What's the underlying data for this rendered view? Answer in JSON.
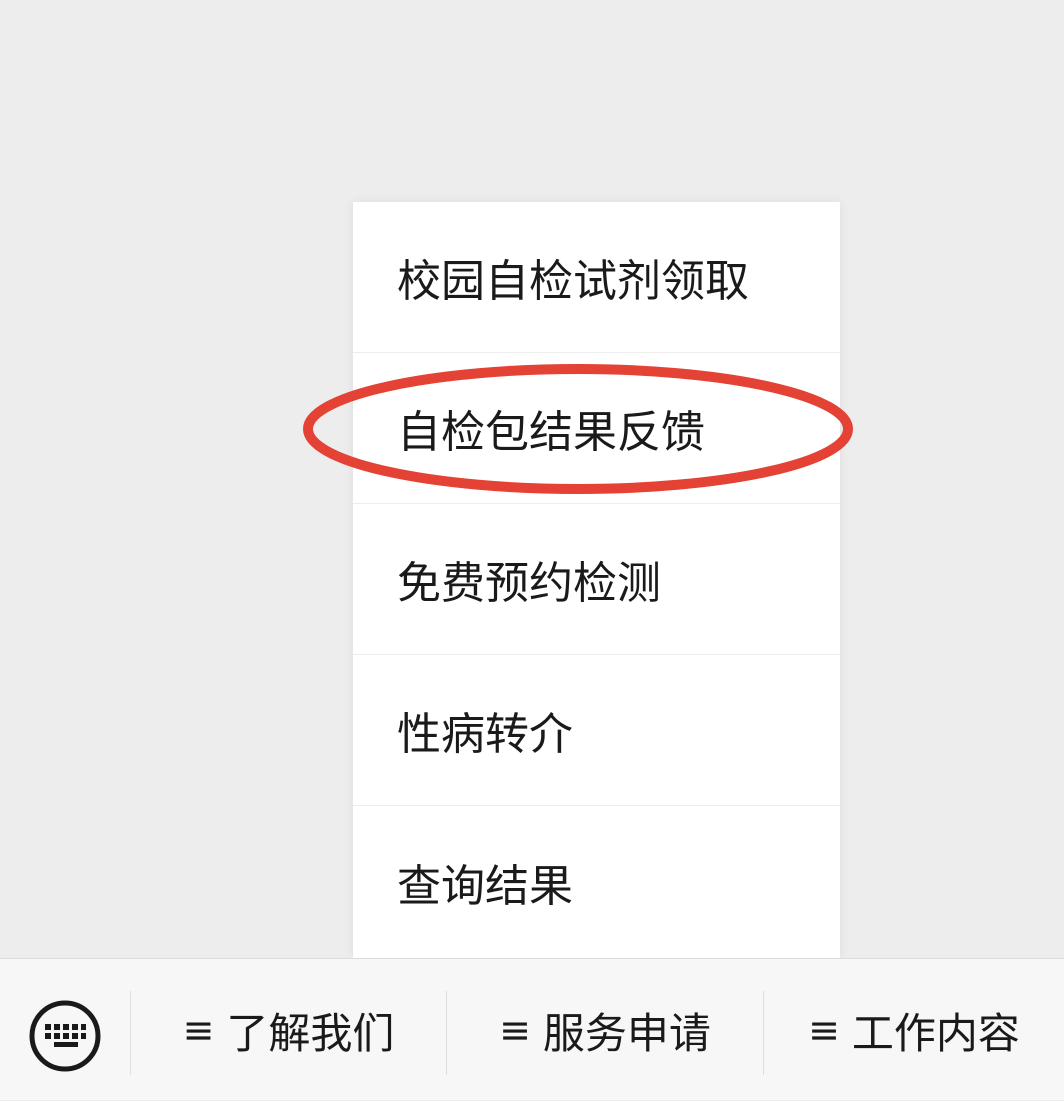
{
  "popup_menu": {
    "items": [
      {
        "label": "校园自检试剂领取"
      },
      {
        "label": "自检包结果反馈"
      },
      {
        "label": "免费预约检测"
      },
      {
        "label": "性病转介"
      },
      {
        "label": "查询结果"
      }
    ],
    "highlighted_index": 1,
    "highlight_color": "#e34234"
  },
  "bottom_bar": {
    "keyboard_icon": "keyboard-icon",
    "tab_icon": "≡",
    "tabs": [
      {
        "label": "了解我们"
      },
      {
        "label": "服务申请"
      },
      {
        "label": "工作内容"
      }
    ]
  }
}
